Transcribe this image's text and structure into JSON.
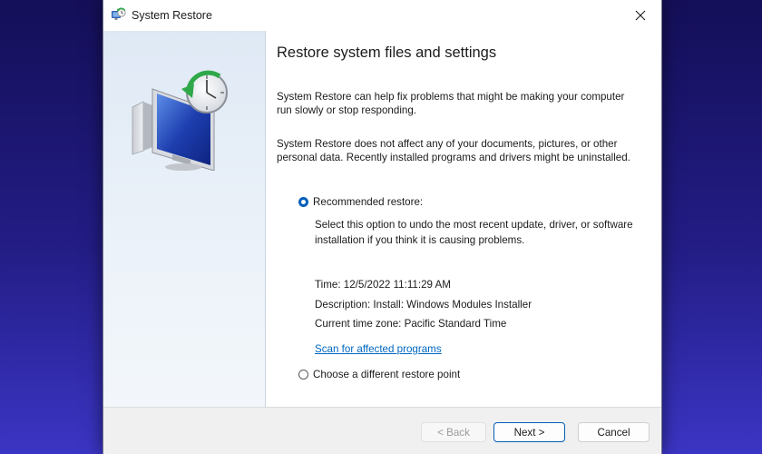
{
  "window": {
    "title": "System Restore",
    "close_symbol": "✕"
  },
  "content": {
    "heading": "Restore system files and settings",
    "para1": "System Restore can help fix problems that might be making your computer run slowly or stop responding.",
    "para2": "System Restore does not affect any of your documents, pictures, or other personal data. Recently installed programs and drivers might be uninstalled.",
    "options": [
      {
        "label": "Recommended restore:",
        "selected": true
      },
      {
        "label": "Choose a different restore point",
        "selected": false
      }
    ],
    "recommended_description": "Select this option to undo the most recent update, driver, or software installation if you think it is causing problems.",
    "details": {
      "time": "Time:  12/5/2022 11:11:29 AM",
      "description": "Description:  Install: Windows Modules Installer",
      "timezone": "Current time zone:  Pacific Standard Time"
    },
    "scan_link": "Scan for affected programs"
  },
  "footer": {
    "back_label": "< Back",
    "next_label": "Next >",
    "cancel_label": "Cancel"
  },
  "icons": {
    "app": "system-restore-icon",
    "illustration": "computer-clock-restore-icon",
    "close": "close-icon"
  },
  "colors": {
    "accent": "#005fb8",
    "link": "#0067c0",
    "background": "#231d86"
  }
}
